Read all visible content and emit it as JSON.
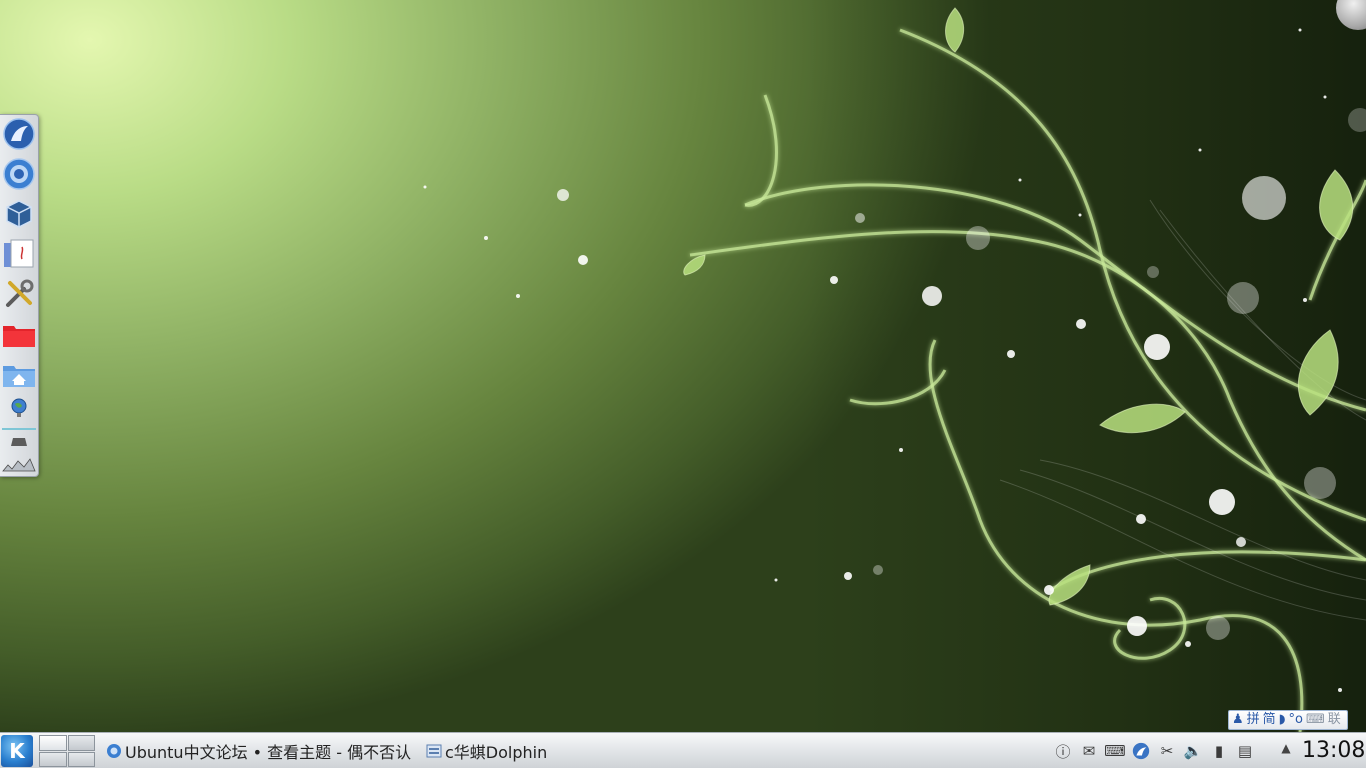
{
  "desktop": {
    "launcher_items": [
      {
        "name": "kde-launcher-icon"
      },
      {
        "name": "chrome-browser-icon"
      },
      {
        "name": "virtualbox-icon"
      },
      {
        "name": "kwrite-editor-icon"
      },
      {
        "name": "system-settings-icon"
      },
      {
        "name": "red-folder-icon"
      },
      {
        "name": "home-folder-icon"
      },
      {
        "name": "network-globe-icon"
      },
      {
        "name": "drive-icon"
      },
      {
        "name": "trash-icon"
      }
    ]
  },
  "ime": {
    "items": [
      "拼",
      "简",
      "联"
    ]
  },
  "taskbar": {
    "kmenu_glyph": "K",
    "tasks": [
      {
        "label": "Ubuntu中文论坛 • 查看主题 - 偶不否认"
      },
      {
        "label": "c华蜞Dolphin"
      }
    ],
    "clock": "13:08",
    "tray_icons": [
      "info-icon",
      "klipper-icon",
      "keyboard-icon",
      "kde-updater-icon",
      "clipboard-scissors-icon",
      "volume-icon",
      "battery-icon",
      "notes-icon"
    ]
  }
}
